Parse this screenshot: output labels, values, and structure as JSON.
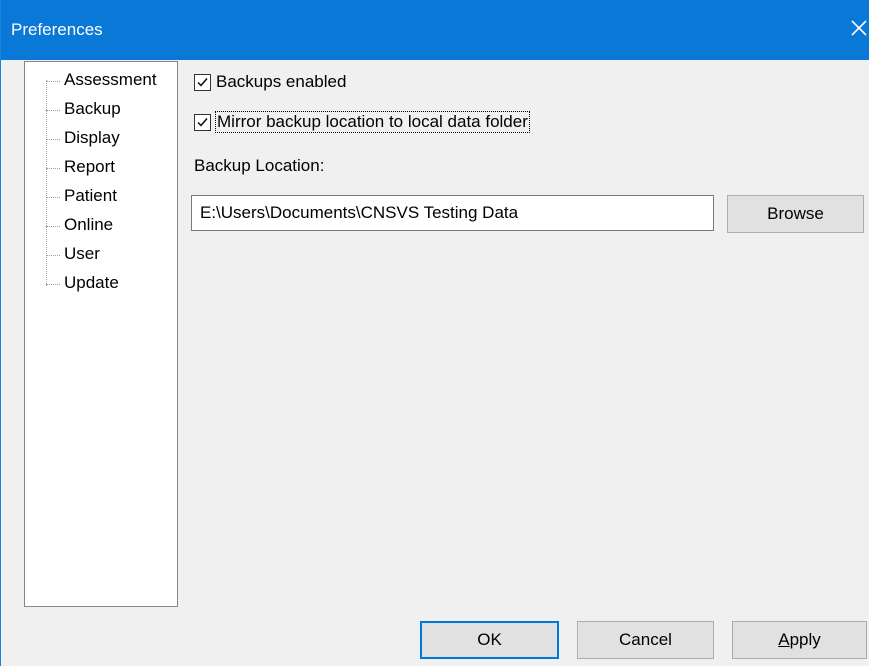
{
  "window": {
    "title": "Preferences",
    "close_glyph": "✕"
  },
  "sidebar": {
    "items": [
      {
        "label": "Assessment"
      },
      {
        "label": "Backup"
      },
      {
        "label": "Display"
      },
      {
        "label": "Report"
      },
      {
        "label": "Patient"
      },
      {
        "label": "Online"
      },
      {
        "label": "User"
      },
      {
        "label": "Update"
      }
    ],
    "selected": "Backup"
  },
  "backup": {
    "enabled_label": "Backups enabled",
    "enabled_checked": true,
    "mirror_label": "Mirror backup location to local data folder",
    "mirror_checked": true,
    "location_label": "Backup Location:",
    "location_value": "E:\\Users\\Documents\\CNSVS Testing Data",
    "browse_label": "Browse"
  },
  "footer": {
    "ok_label": "OK",
    "cancel_label": "Cancel",
    "apply_mnemonic": "A",
    "apply_rest": "pply"
  },
  "colors": {
    "titlebar": "#0a78d7",
    "window_bg": "#f0f0f0",
    "default_button_border": "#0078d7"
  }
}
